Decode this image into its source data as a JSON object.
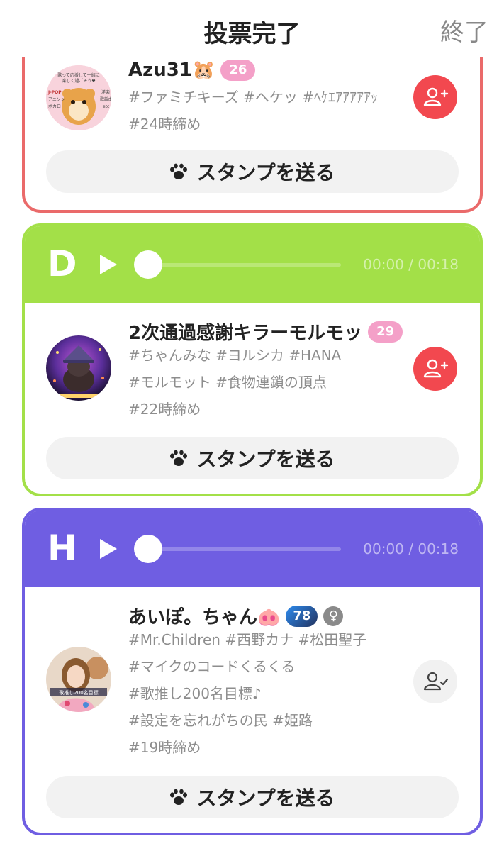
{
  "header": {
    "title": "投票完了",
    "close_label": "終了"
  },
  "cards": {
    "c": {
      "name": "Azu31🐹",
      "level": "26",
      "tags": [
        "#ファミチキーズ #ヘケッ #ﾍｹｴｱｱｱｱｱｯ",
        "#24時締め"
      ],
      "avatar_text": {
        "line1": "歌って応援して一緒に",
        "line2": "楽しく過ごそう❤",
        "left1": "J-POP",
        "left2": "アニソン",
        "left3": "ボカロ",
        "right1": "洋楽",
        "right2": "歌謡曲",
        "right3": "etc"
      },
      "stamp_label": "スタンプを送る"
    },
    "d": {
      "letter": "D",
      "time": "00:00 / 00:18",
      "name": "2次通過感謝キラーモルモッ",
      "level": "29",
      "tags": [
        "#ちゃんみな #ヨルシカ #HANA",
        "#モルモット #食物連鎖の頂点",
        "#22時締め"
      ],
      "stamp_label": "スタンプを送る"
    },
    "h": {
      "letter": "H",
      "time": "00:00 / 00:18",
      "name": "あいぽ。ちゃん🐽",
      "level": "78",
      "gender": "♀",
      "tags": [
        "#Mr.Children #西野カナ #松田聖子",
        "#マイクのコードくるくる",
        "#歌推し200名目標♪",
        "#設定を忘れがちの民 #姫路",
        "#19時締め"
      ],
      "avatar_caption": "歌推し200名目標",
      "stamp_label": "スタンプを送る"
    }
  },
  "colors": {
    "card_c_border": "#ea6a6a",
    "card_d_accent": "#a3e048",
    "card_h_accent": "#6f5ee2",
    "follow_red": "#f2484f",
    "level_pink": "#f4a0c8"
  },
  "icons": {
    "play": "play-icon",
    "paw": "paw-icon",
    "follow": "user-plus-icon",
    "followed": "user-check-icon"
  }
}
